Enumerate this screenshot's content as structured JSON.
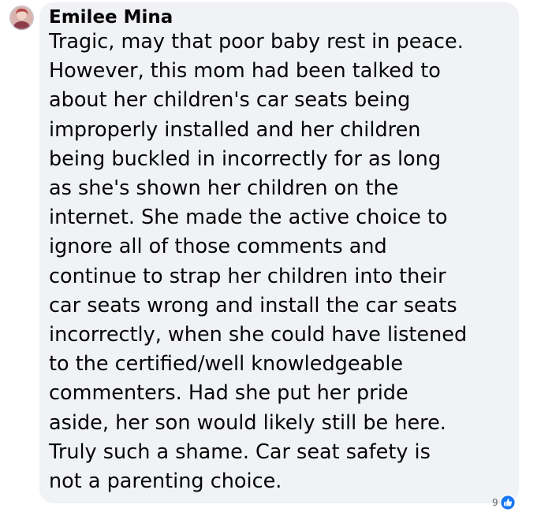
{
  "comment": {
    "author": "Emilee Mina",
    "avatar_icon": "user-avatar",
    "lines": [
      "Tragic, may that poor baby rest in peace.",
      "However, this mom had been talked to",
      "about her children's car seats being",
      "improperly installed and her children",
      "being buckled in incorrectly for as long",
      "as she's shown her children on the",
      "internet. She made the active choice to",
      "ignore all of those comments and",
      "continue to strap her children into their",
      "car seats wrong and install the car seats",
      "incorrectly, when she could have listened",
      "to the certified/well knowledgeable",
      "commenters. Had she put her pride",
      "aside, her son would likely still be here.",
      "Truly such a shame. Car seat safety is",
      "not a parenting choice."
    ],
    "reactions": {
      "count": "9",
      "icon": "like-icon",
      "color": "#1877f2"
    }
  },
  "colors": {
    "bubble": "#f0f2f5",
    "text": "#050505",
    "secondary_text": "#65676b"
  }
}
